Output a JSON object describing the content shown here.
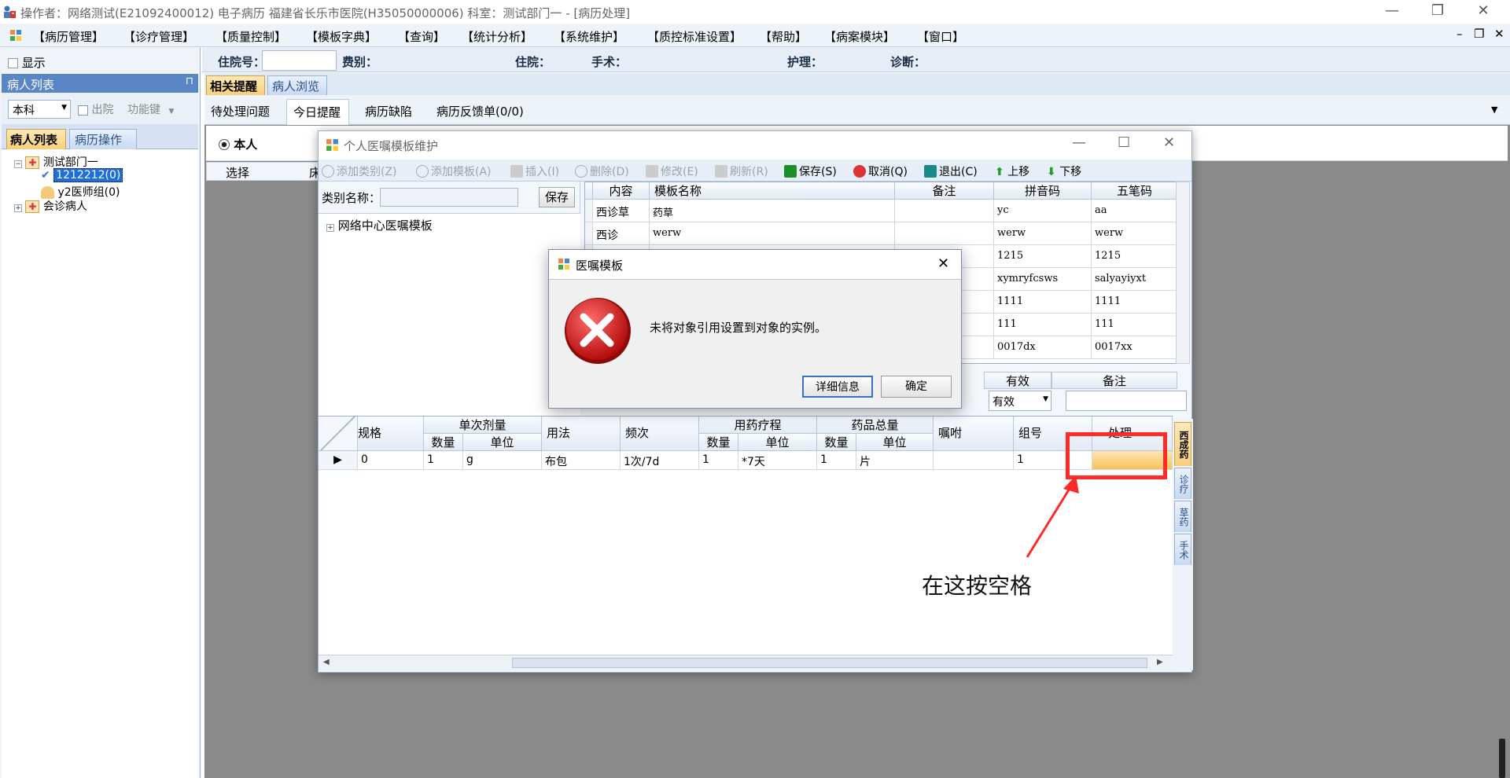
{
  "title_bar": {
    "text": "操作者：网络测试(E21092400012) 电子病历  福建省长乐市医院(H35050000006)  科室：测试部门一 - [病历处理]",
    "minimize": "—",
    "restore": "❐",
    "close": "✕"
  },
  "menu": {
    "items": [
      "【病历管理】",
      "【诊疗管理】",
      "【质量控制】",
      "【模板字典】",
      "【查询】",
      "【统计分析】",
      "【系统维护】",
      "【质控标准设置】",
      "【帮助】",
      "【病案模块】",
      "【窗口】"
    ],
    "mdi_min": "–",
    "mdi_restore": "❐",
    "mdi_close": "✕"
  },
  "left_pane": {
    "show_label": "显示",
    "header": "病人列表",
    "pin": "⊓",
    "dept_select": "本科",
    "discharge_label": "出院",
    "function_key": "功能键",
    "tabs": [
      "病人列表",
      "病历操作"
    ],
    "tree": {
      "dept": "测试部门一",
      "patient": "1212212(0)",
      "group": "y2医师组(0)",
      "consult": "会诊病人"
    }
  },
  "info_bar": {
    "admission_no": "住院号：",
    "category": "费别：",
    "inpatient": "住院：",
    "surgery": "手术：",
    "nursing": "护理：",
    "diagnosis": "诊断："
  },
  "right_tabs": {
    "top": [
      "相关提醒",
      "病人浏览"
    ],
    "sub": [
      "待处理问题",
      "今日提醒",
      "病历缺陷",
      "病历反馈单(0/0)"
    ],
    "radio_label": "本人",
    "col_select": "选择",
    "col_bed": "床"
  },
  "template_window": {
    "title": "个人医嘱模板维护",
    "toolbar": [
      "添加类别(Z)",
      "添加模板(A)",
      "插入(I)",
      "删除(D)",
      "修改(E)",
      "刷新(R)",
      "保存(S)",
      "取消(Q)",
      "退出(C)",
      "上移",
      "下移"
    ],
    "category_label": "类别名称：",
    "save_button": "保存",
    "tree_root": "网络中心医嘱模板",
    "grid_headers": [
      "内容",
      "模板名称",
      "备注",
      "拼音码",
      "五笔码"
    ],
    "grid_rows": [
      [
        "西诊草",
        "药草",
        "",
        "yc",
        "aa"
      ],
      [
        "西诊",
        "werw",
        "",
        "werw",
        "werw"
      ],
      [
        "",
        "",
        "",
        "1215",
        "1215"
      ],
      [
        "",
        "",
        "",
        "xymryfcsws",
        "salyayiyxt"
      ],
      [
        "",
        "",
        "",
        "1111",
        "1111"
      ],
      [
        "",
        "",
        "",
        "111",
        "111"
      ],
      [
        "",
        "",
        "",
        "0017dx",
        "0017xx"
      ]
    ],
    "valid_header": "有效",
    "remark_header": "备注",
    "valid_value": "有效",
    "detail_headers": {
      "spec": "规格",
      "single_dose": "单次剂量",
      "qty": "数量",
      "unit": "单位",
      "usage": "用法",
      "freq": "频次",
      "course": "用药疗程",
      "total": "药品总量",
      "instruction": "嘱咐",
      "group_no": "组号",
      "process": "处理"
    },
    "detail_row": {
      "spec": "0",
      "dose_qty": "1",
      "dose_unit": "g",
      "usage": "布包",
      "freq": "1次/7d",
      "course_qty": "1",
      "course_unit": "*7天",
      "total_qty": "1",
      "total_unit": "片",
      "instruction": "",
      "group_no": "1",
      "process": ""
    },
    "side_tabs": [
      "西成药",
      "诊疗",
      "草药",
      "手术"
    ]
  },
  "dialog": {
    "title": "医嘱模板",
    "message": "未将对象引用设置到对象的实例。",
    "details_button": "详细信息",
    "ok_button": "确定",
    "close": "✕"
  },
  "annotation": {
    "text": "在这按空格"
  }
}
